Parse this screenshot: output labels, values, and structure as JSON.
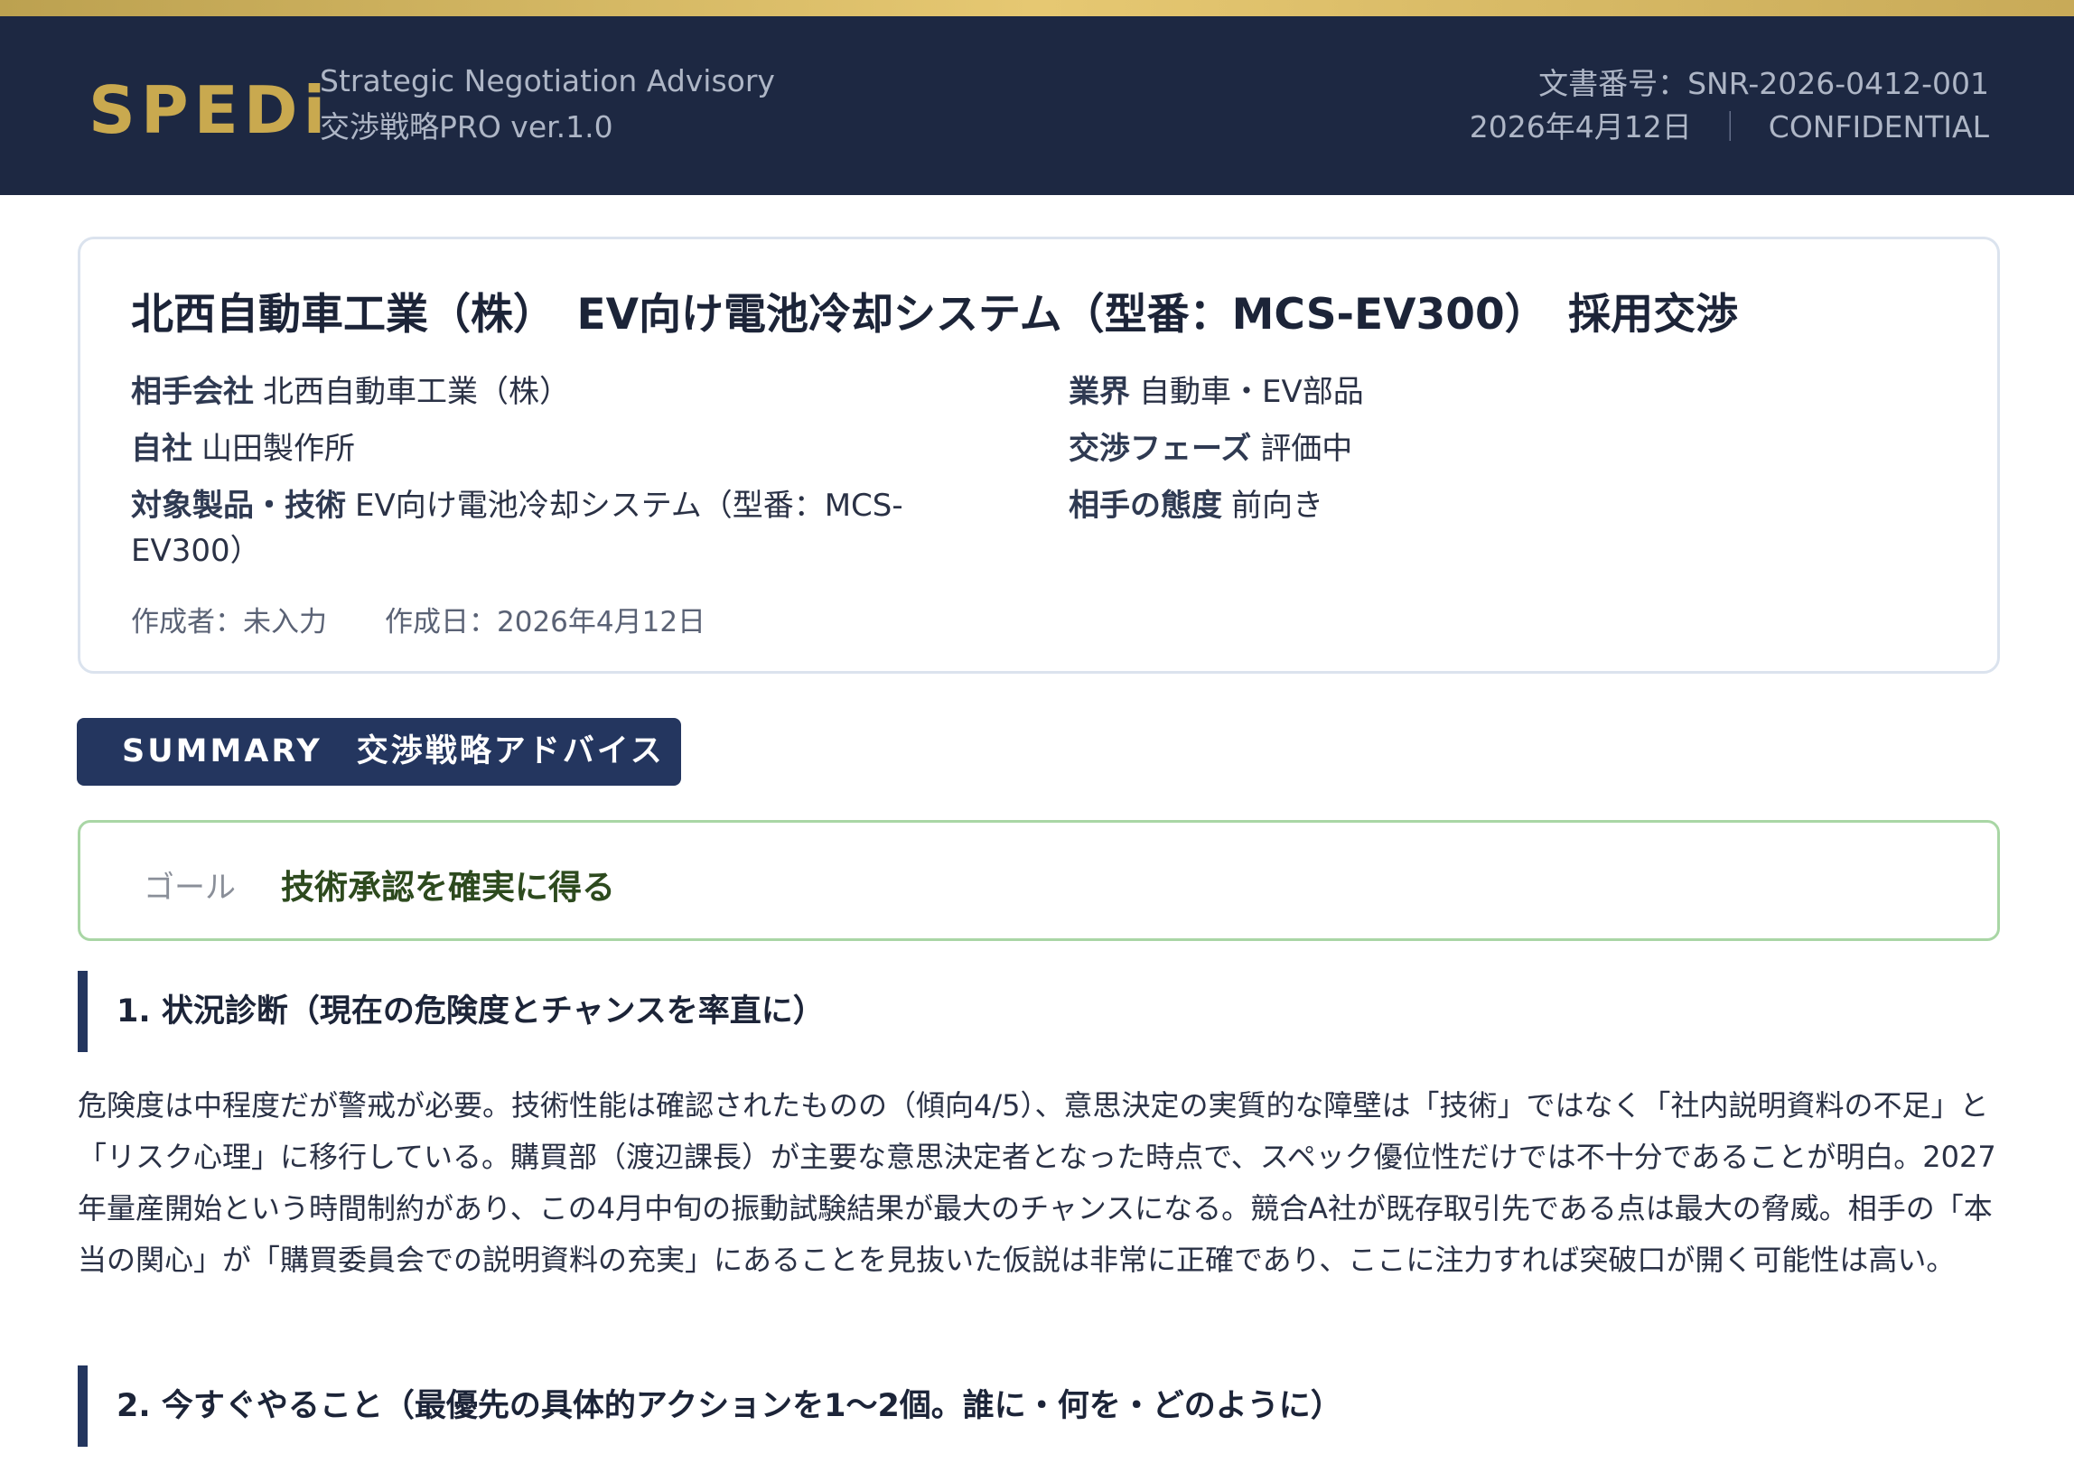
{
  "header": {
    "logo": "SPEDi",
    "subtitle_en": "Strategic Negotiation Advisory",
    "subtitle_jp": "交渉戦略PRO ver.1.0",
    "doc_number": "文書番号：SNR-2026-0412-001",
    "date": "2026年4月12日",
    "separator": "｜",
    "classification": "CONFIDENTIAL"
  },
  "info": {
    "title": "北西自動車工業（株）　EV向け電池冷却システム（型番：MCS-EV300）　採用交渉",
    "counterparty_label": "相手会社",
    "counterparty": "北西自動車工業（株）",
    "industry_label": "業界",
    "industry": "自動車・EV部品",
    "self_label": "自社",
    "self": "山田製作所",
    "phase_label": "交渉フェーズ",
    "phase": "評価中",
    "product_label": "対象製品・技術",
    "product": "EV向け電池冷却システム（型番：MCS-EV300）",
    "attitude_label": "相手の態度",
    "attitude": "前向き",
    "author": "作成者：未入力",
    "created": "作成日：2026年4月12日"
  },
  "summary": {
    "badge": "SUMMARY　交渉戦略アドバイス",
    "goal_label": "ゴール",
    "goal": "技術承認を確実に得る"
  },
  "sections": [
    {
      "heading": "1. 状況診断（現在の危険度とチャンスを率直に）",
      "body": "危険度は中程度だが警戒が必要。技術性能は確認されたものの（傾向4/5）、意思決定の実質的な障壁は「技術」ではなく「社内説明資料の不足」と「リスク心理」に移行している。購買部（渡辺課長）が主要な意思決定者となった時点で、スペック優位性だけでは不十分であることが明白。2027年量産開始という時間制約があり、この4月中旬の振動試験結果が最大のチャンスになる。競合A社が既存取引先である点は最大の脅威。相手の「本当の関心」が「購買委員会での説明資料の充実」にあることを見抜いた仮説は非常に正確であり、ここに注力すれば突破口が開く可能性は高い。"
    },
    {
      "heading": "2. 今すぐやること（最優先の具体的アクションを1〜2個。誰に・何を・どのように）"
    }
  ]
}
